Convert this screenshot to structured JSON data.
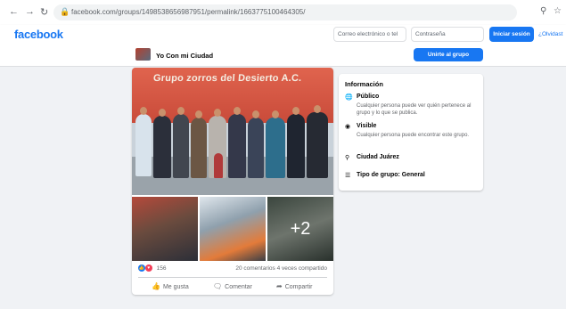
{
  "browser": {
    "back_icon": "arrow-left-icon",
    "forward_icon": "arrow-right-icon",
    "reload_icon": "reload-icon",
    "url": "facebook.com/groups/1498538656987951/permalink/1663775100464305/"
  },
  "header": {
    "logo": "facebook",
    "email_placeholder": "Correo electrónico o tel",
    "password_placeholder": "Contraseña",
    "login_label": "Iniciar sesión",
    "forgot_label": "¿Olvidast"
  },
  "group": {
    "name": "Yo Con mi Ciudad",
    "join_label": "Unirte al grupo"
  },
  "post": {
    "banner_text": "Grupo zorros del Desierto A.C.",
    "more_photos": "+2",
    "reaction_count": "156",
    "comments": "20 comentarios",
    "shares": "4 veces compartido",
    "actions": {
      "like": "Me gusta",
      "comment": "Comentar",
      "share": "Compartir"
    }
  },
  "info": {
    "title": "Información",
    "items": [
      {
        "icon": "globe-icon",
        "title": "Público",
        "desc": "Cualquier persona puede ver quién pertenece al grupo y lo que se publica."
      },
      {
        "icon": "eye-icon",
        "title": "Visible",
        "desc": "Cualquier persona puede encontrar este grupo."
      },
      {
        "icon": "location-pin-icon",
        "title": "Ciudad Juárez",
        "desc": ""
      },
      {
        "icon": "group-icon",
        "title": "Tipo de grupo: General",
        "desc": ""
      }
    ]
  },
  "colors": {
    "brand": "#1877f2",
    "background": "#f0f2f5"
  }
}
